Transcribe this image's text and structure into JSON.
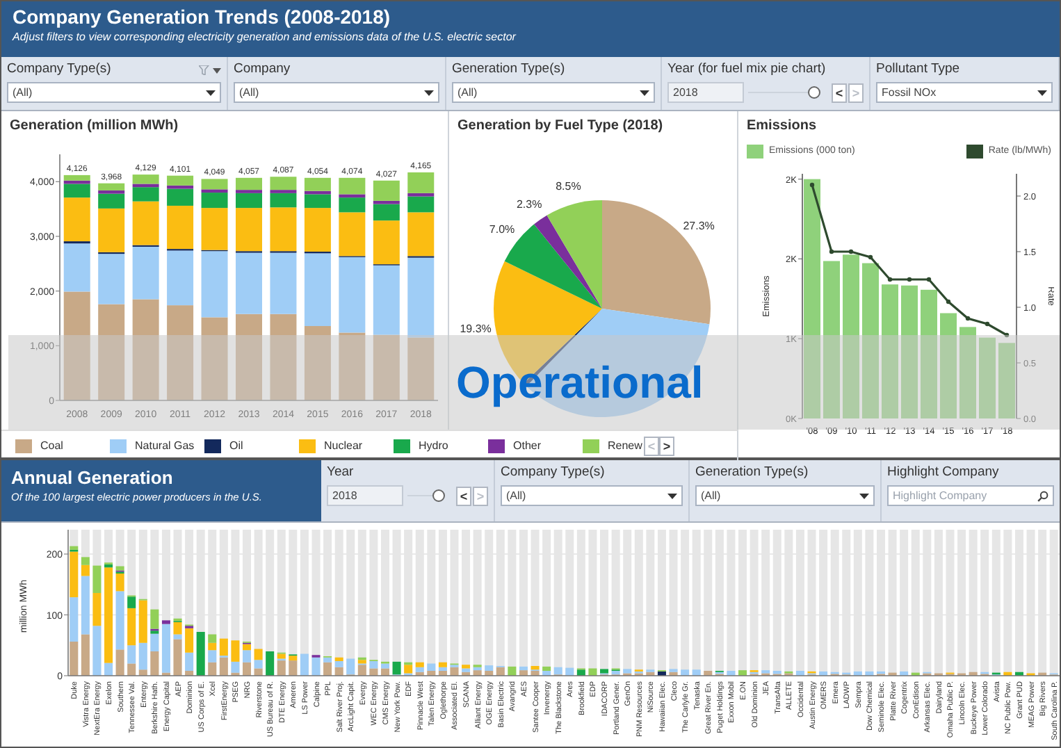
{
  "header": {
    "title": "Company Generation Trends (2008-2018)",
    "subtitle": "Adjust filters to view corresponding electricity generation and emissions data of the U.S. electric sector"
  },
  "filters": [
    {
      "label": "Company Type(s)",
      "kind": "select",
      "value": "(All)",
      "show_filter_icon": true
    },
    {
      "label": "Company",
      "kind": "select",
      "value": "(All)"
    },
    {
      "label": "Generation Type(s)",
      "kind": "select",
      "value": "(All)"
    },
    {
      "label": "Year (for fuel mix pie chart)",
      "kind": "slider",
      "value": "2018",
      "level": 1,
      "buttons": [
        {
          "label": "<",
          "disabled": false
        },
        {
          "label": ">",
          "disabled": true
        }
      ]
    },
    {
      "label": "Pollutant Type",
      "kind": "select",
      "value": "Fossil NOx"
    }
  ],
  "generation": {
    "title": "Generation (million MWh)",
    "chart_data": {
      "type": "bar",
      "stacked": true,
      "categories": [
        "2008",
        "2009",
        "2010",
        "2011",
        "2012",
        "2013",
        "2014",
        "2015",
        "2016",
        "2017",
        "2018"
      ],
      "ylim": [
        0,
        4500
      ],
      "yticks": [
        {
          "value": 0,
          "label": "0"
        },
        {
          "value": 1000,
          "label": "1,000"
        },
        {
          "value": 2000,
          "label": "2,000"
        },
        {
          "value": 3000,
          "label": "3,000"
        },
        {
          "value": 4000,
          "label": "4,000"
        }
      ],
      "value_labels": [
        "4,126",
        "3,968",
        "4,129",
        "4,101",
        "4,049",
        "4,057",
        "4,087",
        "4,054",
        "4,074",
        "4,027",
        "4,165"
      ],
      "series": [
        {
          "name": "Coal",
          "color": "#c8a987",
          "values": [
            1990,
            1760,
            1850,
            1740,
            1520,
            1580,
            1580,
            1360,
            1240,
            1200,
            1150
          ]
        },
        {
          "name": "Natural Gas",
          "color": "#9fcdf6",
          "values": [
            880,
            920,
            960,
            1000,
            1210,
            1120,
            1120,
            1330,
            1380,
            1270,
            1460
          ]
        },
        {
          "name": "Oil",
          "color": "#13295c",
          "values": [
            40,
            30,
            30,
            30,
            20,
            30,
            30,
            30,
            20,
            20,
            30
          ]
        },
        {
          "name": "Nuclear",
          "color": "#fbbd12",
          "values": [
            800,
            800,
            800,
            790,
            770,
            790,
            800,
            800,
            800,
            800,
            800
          ]
        },
        {
          "name": "Hydro",
          "color": "#19a94c",
          "values": [
            250,
            270,
            260,
            310,
            280,
            270,
            260,
            250,
            270,
            300,
            290
          ]
        },
        {
          "name": "Other",
          "color": "#7a2f9c",
          "values": [
            60,
            60,
            60,
            60,
            60,
            60,
            60,
            60,
            60,
            60,
            60
          ]
        },
        {
          "name": "Renew",
          "color": "#92d058",
          "values": [
            100,
            130,
            170,
            180,
            190,
            220,
            240,
            240,
            300,
            370,
            380
          ]
        }
      ]
    }
  },
  "fuel_mix": {
    "title": "Generation by Fuel Type (2018)",
    "chart_data": {
      "type": "pie",
      "values": [
        27.3,
        35.0,
        0.6,
        19.3,
        7.0,
        2.3,
        8.5
      ],
      "value_labels": [
        "27.3%",
        null,
        null,
        "19.3%",
        "7.0%",
        "2.3%",
        "8.5%"
      ]
    }
  },
  "legend": {
    "buttons": [
      {
        "label": "<",
        "disabled": true
      },
      {
        "label": ">",
        "disabled": false
      }
    ]
  },
  "emissions": {
    "title": "Emissions",
    "bars": {
      "chart_data": {
        "type": "bar",
        "categories": [
          "'08",
          "'09",
          "'10",
          "'11",
          "'12",
          "'13",
          "'14",
          "'15",
          "'16",
          "'17",
          "'18"
        ],
        "ylabel": "Emissions",
        "ylim": [
          0,
          2300
        ],
        "yticks": [
          {
            "value": 0,
            "label": "0K"
          },
          {
            "value": 750,
            "label": "1K"
          },
          {
            "value": 1500,
            "label": "2K"
          },
          {
            "value": 2250,
            "label": "2K"
          }
        ],
        "series": [
          {
            "name": "Emissions (000 ton)",
            "color": "#8fd17b",
            "values": [
              2250,
              1480,
              1540,
              1460,
              1260,
              1250,
              1210,
              990,
              860,
              760,
              710
            ]
          }
        ]
      }
    },
    "rate": {
      "chart_data": {
        "type": "line",
        "ylabel": "Rate",
        "ylim": [
          0,
          2.2
        ],
        "yticks": [
          {
            "value": 0,
            "label": "0.0"
          },
          {
            "value": 0.5,
            "label": "0.5"
          },
          {
            "value": 1,
            "label": "1.0"
          },
          {
            "value": 1.5,
            "label": "1.5"
          },
          {
            "value": 2,
            "label": "2.0"
          }
        ],
        "series": [
          {
            "name": "Rate (lb/MWh)",
            "color": "#2e4a2e",
            "marker": true,
            "values": [
              2.1,
              1.5,
              1.5,
              1.45,
              1.25,
              1.25,
              1.25,
              1.05,
              0.9,
              0.85,
              0.75
            ]
          }
        ]
      }
    }
  },
  "overlay": {
    "text": "Operational"
  },
  "annual": {
    "title": "Annual Generation",
    "subtitle": "Of the 100 largest electric power producers in the U.S.",
    "filters": [
      {
        "label": "Year",
        "kind": "slider",
        "value": "2018",
        "level": 1,
        "buttons": [
          {
            "label": "<",
            "disabled": false
          },
          {
            "label": ">",
            "disabled": true
          }
        ]
      },
      {
        "label": "Company Type(s)",
        "kind": "select",
        "value": "(All)"
      },
      {
        "label": "Generation Type(s)",
        "kind": "select",
        "value": "(All)"
      },
      {
        "label": "Highlight Company",
        "kind": "search",
        "placeholder": "Highlight Company"
      }
    ],
    "chart_data": {
      "type": "bar",
      "stacked": true,
      "ylabel": "million MWh",
      "ylim": [
        0,
        240
      ],
      "yticks": [
        0,
        100,
        200
      ],
      "categories": [
        "Duke",
        "Vistra Energy",
        "NextEra Energy",
        "Exelon",
        "Southern",
        "Tennessee Val.",
        "Entergy",
        "Berkshire Hath.",
        "Energy Capital",
        "AEP",
        "Dominion",
        "US Corps of E.",
        "Xcel",
        "FirstEnergy",
        "PSEG",
        "NRG",
        "Riverstone",
        "US Bureau of R.",
        "DTE Energy",
        "Ameren",
        "LS Power",
        "Calpine",
        "PPL",
        "Salt River Proj.",
        "ArcLight Capit.",
        "Evergy",
        "WEC Energy",
        "CMS Energy",
        "New York Pow.",
        "EDF",
        "Pinnacle West",
        "Talen Energy",
        "Oglethorpe",
        "Associated El.",
        "SCANA",
        "Alliant Energy",
        "OGE Energy",
        "Basin Electric",
        "Avangrid",
        "AES",
        "Santee Cooper",
        "Invenergy",
        "The Blackstone",
        "Ares",
        "Brookfield",
        "EDP",
        "IDACORP",
        "Portland Gener.",
        "GenOn",
        "PNM Resources",
        "NiSource",
        "Hawaiian Elec.",
        "Cleco",
        "The Carlyle Gr.",
        "Tenaska",
        "Great River En.",
        "Puget Holdings",
        "Exxon Mobil",
        "E.ON",
        "Old Dominion",
        "JEA",
        "TransAlta",
        "ALLETE",
        "Occidental",
        "Austin Energy",
        "OMERS",
        "Emera",
        "LADWP",
        "Sempra",
        "Dow Chemical",
        "Seminole Elec.",
        "Platte River",
        "Cogentrix",
        "ConEdison",
        "Arkansas Elec.",
        "Dairyland",
        "Omaha Public P.",
        "Lincoln Elec.",
        "Buckeye Power",
        "Lower Colorado",
        "Avista",
        "NC Public Pow.",
        "Grant PUD",
        "MEAG Power",
        "Big Rivers",
        "South Carolina P."
      ],
      "series": [
        {
          "color": "#c8a987",
          "values": [
            56,
            68,
            0,
            0,
            43,
            20,
            10,
            40,
            5,
            60,
            8,
            0,
            22,
            30,
            5,
            22,
            12,
            0,
            25,
            25,
            0,
            0,
            22,
            14,
            2,
            18,
            12,
            12,
            0,
            0,
            6,
            8,
            8,
            14,
            6,
            9,
            8,
            14,
            0,
            9,
            8,
            0,
            2,
            0,
            0,
            0,
            2,
            2,
            4,
            4,
            6,
            0,
            6,
            0,
            0,
            8,
            3,
            0,
            0,
            3,
            4,
            3,
            4,
            0,
            2,
            0,
            3,
            2,
            0,
            0,
            3,
            5,
            0,
            0,
            4,
            4,
            3,
            4,
            6,
            3,
            0,
            0,
            0,
            0,
            5,
            2
          ]
        },
        {
          "color": "#9fcdf6",
          "values": [
            73,
            96,
            82,
            21,
            96,
            30,
            44,
            29,
            80,
            8,
            30,
            0,
            20,
            3,
            18,
            20,
            14,
            0,
            3,
            0,
            36,
            30,
            8,
            10,
            26,
            2,
            12,
            8,
            2,
            4,
            8,
            12,
            6,
            4,
            6,
            5,
            9,
            2,
            0,
            6,
            2,
            8,
            12,
            13,
            0,
            0,
            2,
            6,
            7,
            3,
            4,
            0,
            5,
            10,
            10,
            0,
            3,
            8,
            0,
            3,
            5,
            5,
            0,
            8,
            2,
            7,
            3,
            3,
            7,
            7,
            4,
            0,
            7,
            0,
            2,
            0,
            0,
            0,
            0,
            3,
            2,
            0,
            0,
            0,
            0,
            2
          ]
        },
        {
          "color": "#13295c",
          "values": [
            0,
            0,
            0,
            0,
            0,
            0,
            0,
            0,
            0,
            0,
            0,
            0,
            0,
            0,
            0,
            0,
            0,
            0,
            0,
            0,
            0,
            0,
            0,
            0,
            0,
            0,
            0,
            0,
            0,
            0,
            0,
            0,
            0,
            0,
            0,
            0,
            0,
            0,
            0,
            0,
            0,
            0,
            0,
            0,
            0,
            0,
            0,
            0,
            0,
            0,
            0,
            7,
            0,
            0,
            0,
            0,
            0,
            0,
            0,
            0,
            0,
            0,
            0,
            0,
            0,
            0,
            0,
            0,
            0,
            0,
            0,
            0,
            0,
            0,
            0,
            0,
            0,
            0,
            0,
            0,
            0,
            0,
            0,
            0,
            0,
            0
          ]
        },
        {
          "color": "#fbbd12",
          "values": [
            75,
            18,
            54,
            157,
            29,
            61,
            70,
            0,
            0,
            20,
            40,
            0,
            12,
            28,
            35,
            10,
            18,
            0,
            8,
            8,
            0,
            0,
            0,
            6,
            0,
            6,
            0,
            0,
            0,
            14,
            8,
            0,
            8,
            0,
            6,
            0,
            0,
            0,
            0,
            0,
            6,
            0,
            0,
            0,
            0,
            0,
            0,
            0,
            0,
            3,
            0,
            0,
            0,
            0,
            0,
            0,
            0,
            0,
            0,
            3,
            0,
            0,
            0,
            0,
            3,
            0,
            0,
            0,
            0,
            0,
            0,
            0,
            0,
            0,
            0,
            0,
            2,
            0,
            0,
            0,
            0,
            6,
            0,
            4,
            0,
            0
          ]
        },
        {
          "color": "#19a94c",
          "values": [
            3,
            0,
            0,
            5,
            3,
            19,
            0,
            5,
            0,
            2,
            0,
            72,
            0,
            0,
            0,
            0,
            0,
            40,
            0,
            2,
            0,
            0,
            0,
            0,
            0,
            0,
            0,
            0,
            21,
            0,
            0,
            0,
            0,
            0,
            0,
            0,
            0,
            0,
            0,
            0,
            0,
            0,
            0,
            0,
            10,
            0,
            7,
            2,
            0,
            0,
            0,
            0,
            0,
            0,
            0,
            0,
            2,
            0,
            0,
            0,
            0,
            0,
            0,
            0,
            0,
            0,
            0,
            0,
            0,
            0,
            0,
            0,
            0,
            0,
            0,
            0,
            0,
            0,
            0,
            0,
            3,
            0,
            6,
            0,
            0,
            0
          ]
        },
        {
          "color": "#7a2f9c",
          "values": [
            0,
            0,
            0,
            0,
            2,
            0,
            0,
            3,
            6,
            0,
            4,
            0,
            0,
            0,
            0,
            2,
            0,
            0,
            0,
            0,
            0,
            4,
            0,
            0,
            0,
            0,
            0,
            0,
            0,
            0,
            0,
            0,
            0,
            0,
            0,
            0,
            0,
            0,
            0,
            0,
            0,
            0,
            0,
            0,
            0,
            0,
            0,
            0,
            0,
            0,
            0,
            0,
            0,
            0,
            0,
            0,
            0,
            0,
            0,
            0,
            0,
            0,
            0,
            0,
            0,
            0,
            0,
            0,
            0,
            0,
            0,
            0,
            0,
            0,
            0,
            0,
            0,
            0,
            0,
            0,
            0,
            0,
            0,
            0,
            0,
            0
          ]
        },
        {
          "color": "#92d058",
          "values": [
            6,
            13,
            45,
            3,
            7,
            2,
            2,
            32,
            0,
            4,
            2,
            0,
            14,
            0,
            0,
            2,
            0,
            0,
            2,
            0,
            0,
            0,
            2,
            0,
            0,
            4,
            2,
            3,
            0,
            4,
            0,
            0,
            0,
            2,
            0,
            4,
            0,
            0,
            15,
            0,
            0,
            7,
            0,
            0,
            2,
            12,
            0,
            2,
            0,
            0,
            0,
            2,
            0,
            0,
            0,
            0,
            0,
            0,
            9,
            0,
            0,
            0,
            3,
            0,
            0,
            0,
            0,
            0,
            0,
            0,
            0,
            0,
            0,
            5,
            0,
            0,
            0,
            0,
            0,
            0,
            0,
            0,
            0,
            0,
            0,
            0
          ]
        }
      ]
    }
  }
}
